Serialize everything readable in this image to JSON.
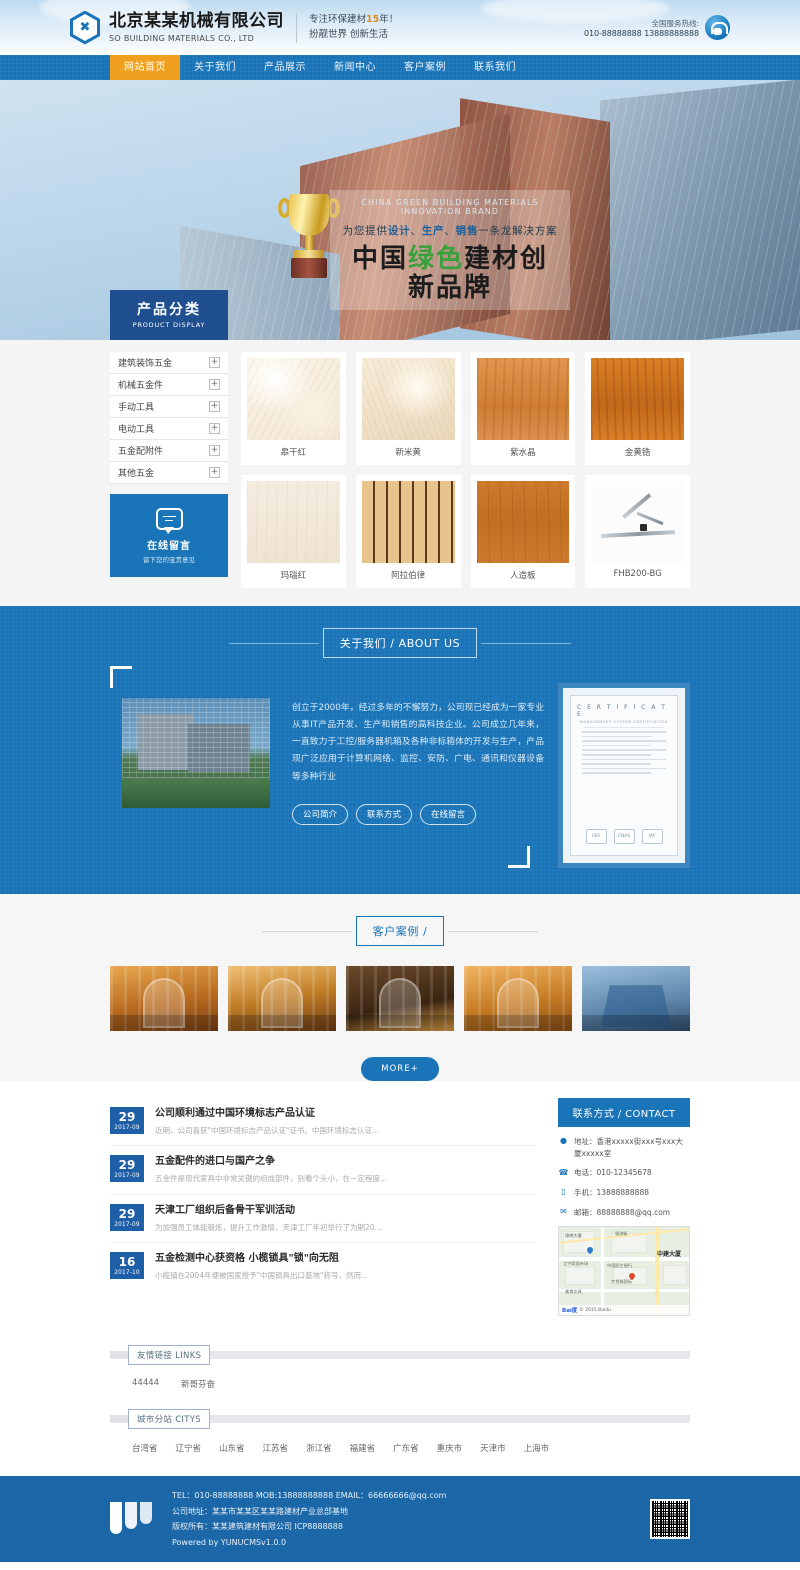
{
  "header": {
    "brand_cn": "北京某某机械有限公司",
    "brand_en": "SO BUILDING MATERIALS CO., LTD",
    "slogan_line1_pre": "专注环保建材",
    "slogan_line1_hl": "15",
    "slogan_line1_post": "年！",
    "slogan_line2": "扮靓世界 创新生活",
    "hotline_label": "全国服务热线:",
    "hotline_numbers": "010-88888888 13888888888"
  },
  "nav": {
    "items": [
      {
        "label": "网站首页",
        "active": true
      },
      {
        "label": "关于我们",
        "active": false
      },
      {
        "label": "产品展示",
        "active": false
      },
      {
        "label": "新闻中心",
        "active": false
      },
      {
        "label": "客户案例",
        "active": false
      },
      {
        "label": "联系我们",
        "active": false
      }
    ]
  },
  "banner": {
    "english": "CHINA GREEN BUILDING MATERIALS INNOVATION BRAND",
    "subtitle_pre": "为您提供",
    "subtitle_b1": "设计",
    "subtitle_mid1": "、",
    "subtitle_b2": "生产",
    "subtitle_mid2": "、",
    "subtitle_b3": "销售",
    "subtitle_post": "一条龙解决方案",
    "main_pre": "中国",
    "main_green": "绿色",
    "main_post": "建材创新品牌"
  },
  "products": {
    "panel_title_cn": "产品分类",
    "panel_title_en": "PRODUCT DISPLAY",
    "categories": [
      {
        "label": "建筑装饰五金",
        "expand": "+"
      },
      {
        "label": "机械五金件",
        "expand": "+"
      },
      {
        "label": "手动工具",
        "expand": "+"
      },
      {
        "label": "电动工具",
        "expand": "+"
      },
      {
        "label": "五金配附件",
        "expand": "+"
      },
      {
        "label": "其他五金",
        "expand": "+"
      }
    ],
    "message_box": {
      "title": "在线留言",
      "subtitle": "留下您的宝贵意见"
    },
    "items": [
      {
        "label": "皋干红",
        "tex": "tx-marble-a"
      },
      {
        "label": "新米黄",
        "tex": "tx-marble-b"
      },
      {
        "label": "紫水晶",
        "tex": "tx-wood-a"
      },
      {
        "label": "金黄锆",
        "tex": "tx-wood-b"
      },
      {
        "label": "玛瑙红",
        "tex": "tx-light"
      },
      {
        "label": "阿拉伯律",
        "tex": "tx-slats"
      },
      {
        "label": "人造板",
        "tex": "tx-floor"
      },
      {
        "label": "FHB200-BG",
        "tex": "tx-hw"
      }
    ]
  },
  "about": {
    "title": "关于我们 / ABOUT US",
    "text": "创立于2000年，经过多年的不懈努力，公司现已经成为一家专业从事IT产品开发、生产和销售的高科技企业。公司成立几年来，一直致力于工控/服务器机箱及各种非标箱体的开发与生产，产品现广泛应用于计算机网络、监控、安防、广电、通讯和仪器设备等多种行业",
    "buttons": [
      "公司简介",
      "联系方式",
      "在线留言"
    ],
    "certificate": {
      "title": "C E R T I F I C A T E",
      "subtitle": "MANAGEMENT SYSTEM CERTIFICATION",
      "seals": [
        "ISO",
        "CNAS",
        "IAF"
      ]
    }
  },
  "cases": {
    "title": "客户案例 /",
    "more_label": "MORE+",
    "items": [
      {
        "name": "case-1"
      },
      {
        "name": "case-2"
      },
      {
        "name": "case-3"
      },
      {
        "name": "case-4"
      },
      {
        "name": "case-5"
      }
    ]
  },
  "news": {
    "items": [
      {
        "day": "29",
        "month": "2017-09",
        "title": "公司顺利通过中国环境标志产品认证",
        "desc": "近期，公司喜获\"中国环境标志产品认证\"证书。中国环境标志认证..."
      },
      {
        "day": "29",
        "month": "2017-09",
        "title": "五金配件的进口与国产之争",
        "desc": "五金件是现代家具中非常关键的组成部件，别看个头小，在一定程度..."
      },
      {
        "day": "29",
        "month": "2017-09",
        "title": "天津工厂组织后备骨干军训活动",
        "desc": "为加强员工体能锻炼，提升工作激情，天津工厂年初举行了为期20..."
      },
      {
        "day": "16",
        "month": "2017-10",
        "title": "五金检测中心获资格 小榄锁具\"锁\"向无阻",
        "desc": "小榄镇在2004年便被国家授予\"中国锁具出口基地\"称号，然而..."
      }
    ]
  },
  "contact": {
    "title": "联系方式 / CONTACT",
    "rows": [
      {
        "icon": "location-icon",
        "glyph": "●",
        "text": "地址：香港xxxxx街xxx号xxx大厦xxxxx室"
      },
      {
        "icon": "phone-icon",
        "glyph": "☎",
        "text": "电话：010-12345678"
      },
      {
        "icon": "mobile-icon",
        "glyph": "▯",
        "text": "手机：13888888888"
      },
      {
        "icon": "email-icon",
        "glyph": "✉",
        "text": "邮箱：88888888@qq.com"
      }
    ],
    "map": {
      "labels": [
        "锦绣大厦",
        "中建大厦",
        "银湖街",
        "江宁家居市场",
        "大悦城国际",
        "中国民生银行",
        "中建大厦",
        "美食文具"
      ],
      "attribution": "© 2015 Baidu",
      "logo": "Bai度"
    }
  },
  "links": {
    "friend_label": "友情链接 LINKS",
    "friend_items": [
      "44444",
      "新哥芬奋"
    ],
    "city_label": "城市分站 CITYS",
    "city_items": [
      "台湾省",
      "辽宁省",
      "山东省",
      "江苏省",
      "浙江省",
      "福建省",
      "广东省",
      "重庆市",
      "天津市",
      "上海市"
    ]
  },
  "footer": {
    "line1": "TEL：010-88888888 MOB:13888888888 EMAIL：66666666@qq.com",
    "line2": "公司地址：某某市某某区某某路建材产业总部基地",
    "line3": "版权所有：某某建筑建材有限公司 ICP8888888",
    "line4": "Powered by YUNUCMSv1.0.0"
  },
  "colors": {
    "primary": "#1974b8",
    "accent": "#f0a01e",
    "dark_blue": "#1f4f8f",
    "green": "#3ba03b"
  }
}
